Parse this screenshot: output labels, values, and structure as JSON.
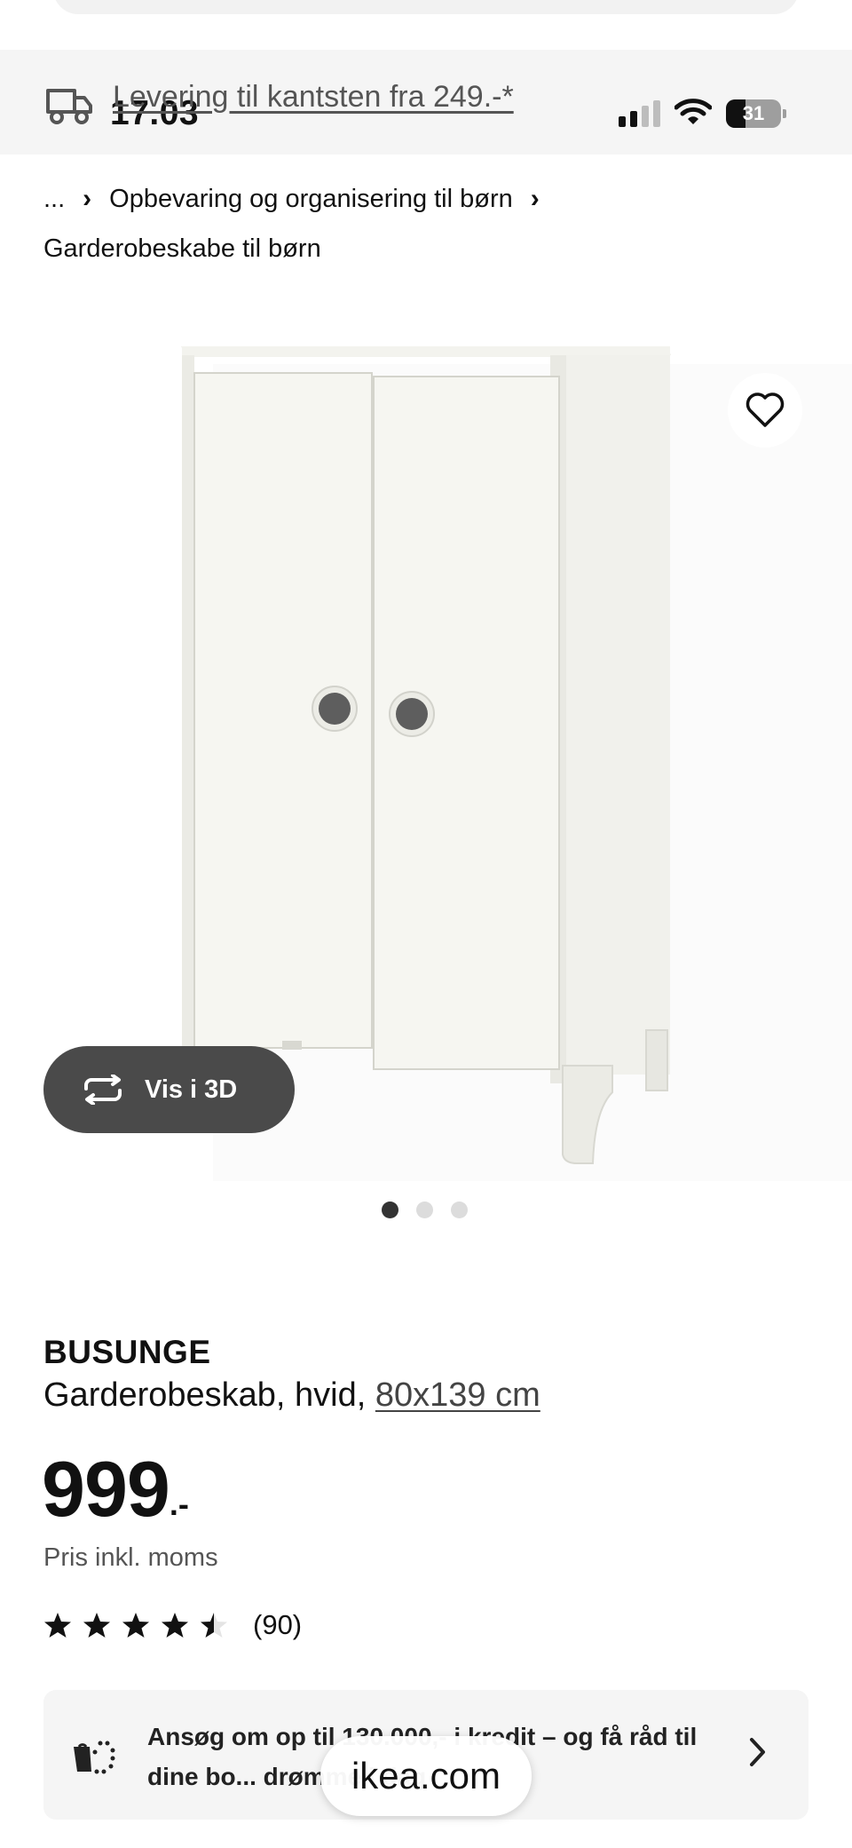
{
  "status_bar": {
    "time": "17.03",
    "battery": "31"
  },
  "delivery": {
    "text": "Levering til kantsten fra 249.-*"
  },
  "breadcrumb": {
    "ellipsis": "...",
    "parent": "Opbevaring og organisering til børn",
    "current": "Garderobeskabe til børn"
  },
  "gallery": {
    "view3d_label": "Vis i 3D",
    "image_count": 3,
    "active_index": 0
  },
  "product": {
    "name": "BUSUNGE",
    "description": "Garderobeskab, hvid,",
    "size": "80x139 cm",
    "price_main": "999",
    "price_suffix": ".-",
    "price_note": "Pris inkl. moms",
    "rating": 4.5,
    "rating_count": "(90)"
  },
  "credit_banner": {
    "text": "Ansøg om op til 130.000,- i kredit – og få råd til dine bo... drømme i dag"
  },
  "browser": {
    "url": "ikea.com"
  }
}
